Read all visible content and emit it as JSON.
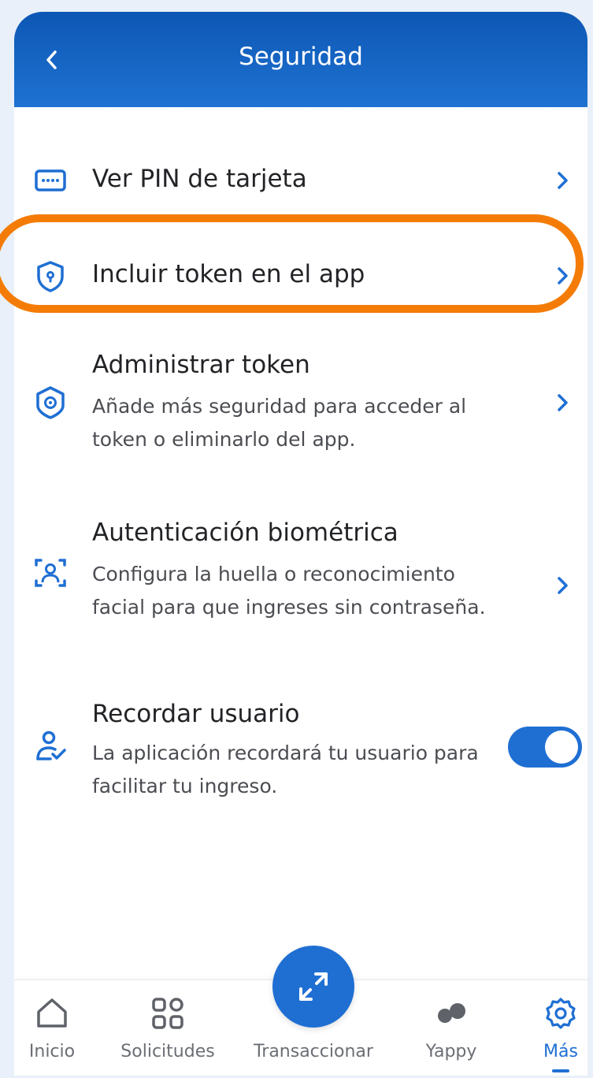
{
  "header": {
    "title": "Seguridad"
  },
  "items": [
    {
      "title": "Ver PIN de tarjeta"
    },
    {
      "title": "Incluir token en el app"
    },
    {
      "title": "Administrar token",
      "description": "Añade más seguridad para acceder al token o eliminarlo del app."
    },
    {
      "title": "Autenticación biométrica",
      "description": "Configura la huella o reconocimiento facial para que ingreses sin contraseña."
    },
    {
      "title": "Recordar usuario",
      "description": "La aplicación recordará tu usuario para facilitar tu ingreso.",
      "toggle_on": true
    }
  ],
  "nav": [
    {
      "label": "Inicio",
      "icon": "home-icon"
    },
    {
      "label": "Solicitudes",
      "icon": "grid-icon"
    },
    {
      "label": "Transaccionar",
      "icon": "swap-arrows-icon"
    },
    {
      "label": "Yappy",
      "icon": "yappy-icon"
    },
    {
      "label": "Más",
      "icon": "gear-icon",
      "active": true
    }
  ],
  "colors": {
    "primary": "#1f6fd3",
    "header_dark": "#0d57b4",
    "highlight": "#f47c06"
  }
}
